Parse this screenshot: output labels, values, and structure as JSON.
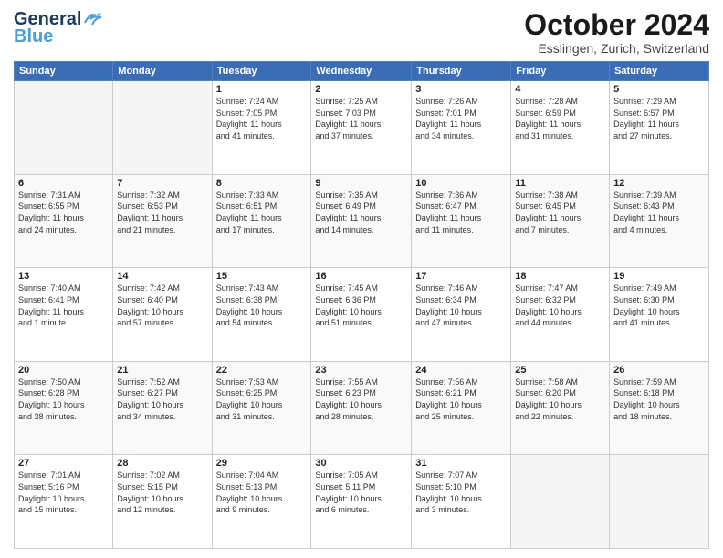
{
  "logo": {
    "line1": "General",
    "line2": "Blue"
  },
  "title": "October 2024",
  "location": "Esslingen, Zurich, Switzerland",
  "header_days": [
    "Sunday",
    "Monday",
    "Tuesday",
    "Wednesday",
    "Thursday",
    "Friday",
    "Saturday"
  ],
  "weeks": [
    [
      {
        "day": "",
        "info": ""
      },
      {
        "day": "",
        "info": ""
      },
      {
        "day": "1",
        "info": "Sunrise: 7:24 AM\nSunset: 7:05 PM\nDaylight: 11 hours\nand 41 minutes."
      },
      {
        "day": "2",
        "info": "Sunrise: 7:25 AM\nSunset: 7:03 PM\nDaylight: 11 hours\nand 37 minutes."
      },
      {
        "day": "3",
        "info": "Sunrise: 7:26 AM\nSunset: 7:01 PM\nDaylight: 11 hours\nand 34 minutes."
      },
      {
        "day": "4",
        "info": "Sunrise: 7:28 AM\nSunset: 6:59 PM\nDaylight: 11 hours\nand 31 minutes."
      },
      {
        "day": "5",
        "info": "Sunrise: 7:29 AM\nSunset: 6:57 PM\nDaylight: 11 hours\nand 27 minutes."
      }
    ],
    [
      {
        "day": "6",
        "info": "Sunrise: 7:31 AM\nSunset: 6:55 PM\nDaylight: 11 hours\nand 24 minutes."
      },
      {
        "day": "7",
        "info": "Sunrise: 7:32 AM\nSunset: 6:53 PM\nDaylight: 11 hours\nand 21 minutes."
      },
      {
        "day": "8",
        "info": "Sunrise: 7:33 AM\nSunset: 6:51 PM\nDaylight: 11 hours\nand 17 minutes."
      },
      {
        "day": "9",
        "info": "Sunrise: 7:35 AM\nSunset: 6:49 PM\nDaylight: 11 hours\nand 14 minutes."
      },
      {
        "day": "10",
        "info": "Sunrise: 7:36 AM\nSunset: 6:47 PM\nDaylight: 11 hours\nand 11 minutes."
      },
      {
        "day": "11",
        "info": "Sunrise: 7:38 AM\nSunset: 6:45 PM\nDaylight: 11 hours\nand 7 minutes."
      },
      {
        "day": "12",
        "info": "Sunrise: 7:39 AM\nSunset: 6:43 PM\nDaylight: 11 hours\nand 4 minutes."
      }
    ],
    [
      {
        "day": "13",
        "info": "Sunrise: 7:40 AM\nSunset: 6:41 PM\nDaylight: 11 hours\nand 1 minute."
      },
      {
        "day": "14",
        "info": "Sunrise: 7:42 AM\nSunset: 6:40 PM\nDaylight: 10 hours\nand 57 minutes."
      },
      {
        "day": "15",
        "info": "Sunrise: 7:43 AM\nSunset: 6:38 PM\nDaylight: 10 hours\nand 54 minutes."
      },
      {
        "day": "16",
        "info": "Sunrise: 7:45 AM\nSunset: 6:36 PM\nDaylight: 10 hours\nand 51 minutes."
      },
      {
        "day": "17",
        "info": "Sunrise: 7:46 AM\nSunset: 6:34 PM\nDaylight: 10 hours\nand 47 minutes."
      },
      {
        "day": "18",
        "info": "Sunrise: 7:47 AM\nSunset: 6:32 PM\nDaylight: 10 hours\nand 44 minutes."
      },
      {
        "day": "19",
        "info": "Sunrise: 7:49 AM\nSunset: 6:30 PM\nDaylight: 10 hours\nand 41 minutes."
      }
    ],
    [
      {
        "day": "20",
        "info": "Sunrise: 7:50 AM\nSunset: 6:28 PM\nDaylight: 10 hours\nand 38 minutes."
      },
      {
        "day": "21",
        "info": "Sunrise: 7:52 AM\nSunset: 6:27 PM\nDaylight: 10 hours\nand 34 minutes."
      },
      {
        "day": "22",
        "info": "Sunrise: 7:53 AM\nSunset: 6:25 PM\nDaylight: 10 hours\nand 31 minutes."
      },
      {
        "day": "23",
        "info": "Sunrise: 7:55 AM\nSunset: 6:23 PM\nDaylight: 10 hours\nand 28 minutes."
      },
      {
        "day": "24",
        "info": "Sunrise: 7:56 AM\nSunset: 6:21 PM\nDaylight: 10 hours\nand 25 minutes."
      },
      {
        "day": "25",
        "info": "Sunrise: 7:58 AM\nSunset: 6:20 PM\nDaylight: 10 hours\nand 22 minutes."
      },
      {
        "day": "26",
        "info": "Sunrise: 7:59 AM\nSunset: 6:18 PM\nDaylight: 10 hours\nand 18 minutes."
      }
    ],
    [
      {
        "day": "27",
        "info": "Sunrise: 7:01 AM\nSunset: 5:16 PM\nDaylight: 10 hours\nand 15 minutes."
      },
      {
        "day": "28",
        "info": "Sunrise: 7:02 AM\nSunset: 5:15 PM\nDaylight: 10 hours\nand 12 minutes."
      },
      {
        "day": "29",
        "info": "Sunrise: 7:04 AM\nSunset: 5:13 PM\nDaylight: 10 hours\nand 9 minutes."
      },
      {
        "day": "30",
        "info": "Sunrise: 7:05 AM\nSunset: 5:11 PM\nDaylight: 10 hours\nand 6 minutes."
      },
      {
        "day": "31",
        "info": "Sunrise: 7:07 AM\nSunset: 5:10 PM\nDaylight: 10 hours\nand 3 minutes."
      },
      {
        "day": "",
        "info": ""
      },
      {
        "day": "",
        "info": ""
      }
    ]
  ]
}
